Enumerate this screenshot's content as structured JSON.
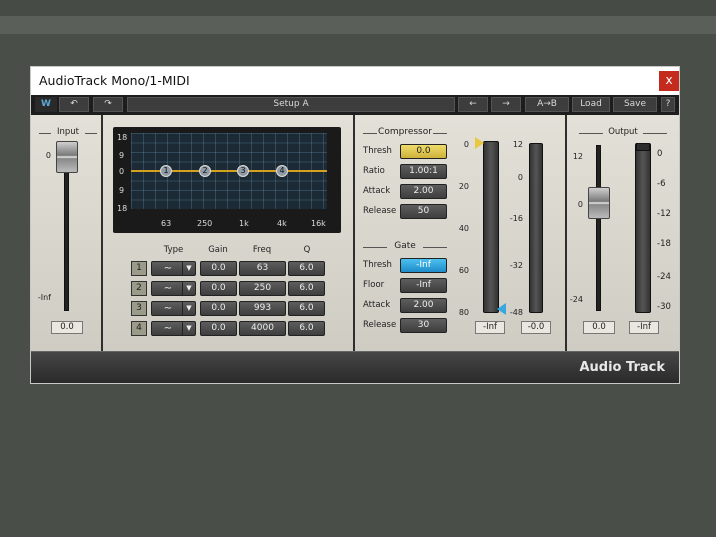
{
  "window": {
    "title": "AudioTrack Mono/1-MIDI",
    "close_glyph": "x"
  },
  "toolbar": {
    "logo_glyph": "W",
    "undo_glyph": "↶",
    "redo_glyph": "↷",
    "setup_label": "Setup A",
    "prev_glyph": "←",
    "next_glyph": "→",
    "ab_label": "A→B",
    "load_label": "Load",
    "save_label": "Save",
    "help_label": "?"
  },
  "input": {
    "label": "Input",
    "tick_top": "0",
    "tick_bottom": "-Inf",
    "value": "0.0"
  },
  "eq": {
    "y_ticks": [
      "18",
      "9",
      "0",
      "9",
      "18"
    ],
    "x_ticks": [
      "63",
      "250",
      "1k",
      "4k",
      "16k"
    ],
    "nodes": [
      "1",
      "2",
      "3",
      "4"
    ],
    "headers": {
      "type": "Type",
      "gain": "Gain",
      "freq": "Freq",
      "q": "Q"
    },
    "bands": [
      {
        "band": "1",
        "type": "∼",
        "gain": "0.0",
        "freq": "63",
        "q": "6.0"
      },
      {
        "band": "2",
        "type": "∼",
        "gain": "0.0",
        "freq": "250",
        "q": "6.0"
      },
      {
        "band": "3",
        "type": "∼",
        "gain": "0.0",
        "freq": "993",
        "q": "6.0"
      },
      {
        "band": "4",
        "type": "∼",
        "gain": "0.0",
        "freq": "4000",
        "q": "6.0"
      }
    ],
    "dropdown_glyph": "▼"
  },
  "compressor": {
    "title": "Compressor",
    "thresh_label": "Thresh",
    "thresh": "0.0",
    "ratio_label": "Ratio",
    "ratio": "1.00:1",
    "attack_label": "Attack",
    "attack": "2.00",
    "release_label": "Release",
    "release": "50"
  },
  "gate": {
    "title": "Gate",
    "thresh_label": "Thresh",
    "thresh": "-Inf",
    "floor_label": "Floor",
    "floor": "-Inf",
    "attack_label": "Attack",
    "attack": "2.00",
    "release_label": "Release",
    "release": "30"
  },
  "dyn_meters": {
    "left_ticks": [
      "0",
      "20",
      "40",
      "60",
      "80"
    ],
    "right_ticks": [
      "12",
      "0",
      "-16",
      "-32",
      "-48"
    ],
    "left_value": "-Inf",
    "right_value": "-0.0"
  },
  "output": {
    "label": "Output",
    "fader_ticks": [
      "12",
      "0",
      "-24"
    ],
    "meter_ticks": [
      "0",
      "-6",
      "-12",
      "-18",
      "-24",
      "-30"
    ],
    "fader_value": "0.0",
    "meter_value": "-Inf"
  },
  "footer": {
    "brand": "Audio Track"
  },
  "colors": {
    "accent_gold": "#e3c84a",
    "accent_blue": "#2aa5e0",
    "eq_curve": "#d4a020",
    "close_red": "#c42b1c"
  }
}
